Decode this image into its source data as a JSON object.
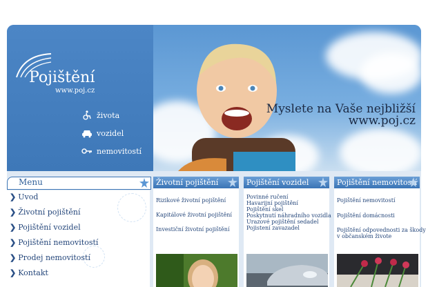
{
  "header": {
    "logo_title": "Pojištění",
    "logo_url": "www.poj.cz",
    "nav": [
      {
        "label": "života",
        "icon": "wheelchair-icon"
      },
      {
        "label": "vozidel",
        "icon": "car-icon"
      },
      {
        "label": "nemovitostí",
        "icon": "key-icon"
      }
    ],
    "slogan_line1": "Myslete na Vaše nejbližší",
    "slogan_line2": "www.poj.cz"
  },
  "menu": {
    "title": "Menu",
    "items": [
      "Uvod",
      "Životní pojištění",
      "Pojištění vozidel",
      "Pojištění nemovitostí",
      "Prodej nemovitostí",
      "Kontakt"
    ]
  },
  "columns": [
    {
      "title": "Životní pojištění",
      "links": [
        "Rizikové životní pojištění",
        "Kapitálové životní pojištění",
        "Investiční životní pojištění"
      ]
    },
    {
      "title": "Pojištění vozidel",
      "links": [
        "Povinné ručení",
        "Havarijní pojištění",
        "Pojištění skel",
        "Poskytnutí náhradního vozidla",
        "Urazové pojištění sedadel",
        "Pojistení zavazadel"
      ]
    },
    {
      "title": "Pojištění nemovitostí",
      "links": [
        "Pojištění nemovitostí",
        "Pojištění domácnosti",
        "Pojištění odpovednosti za škody",
        "v občanském živote"
      ]
    }
  ],
  "colors": {
    "header_blue": "#4f86c4",
    "text_blue": "#24467a",
    "slogan": "#1c2a44"
  }
}
